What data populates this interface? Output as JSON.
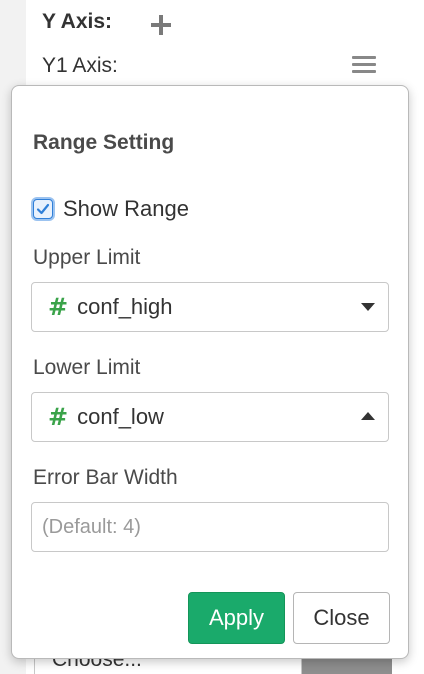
{
  "axis_panel": {
    "title": "Y Axis:",
    "y1_label": "Y1 Axis:",
    "choose_placeholder": "Choose..."
  },
  "popover": {
    "title": "Range Setting",
    "show_range_label": "Show Range",
    "show_range_checked": true,
    "upper_limit": {
      "label": "Upper Limit",
      "value": "conf_high",
      "type_icon": "#"
    },
    "lower_limit": {
      "label": "Lower Limit",
      "value": "conf_low",
      "type_icon": "#"
    },
    "error_bar_width": {
      "label": "Error Bar Width",
      "value": "",
      "placeholder": "(Default: 4)"
    },
    "apply_label": "Apply",
    "close_label": "Close"
  },
  "icons": {
    "add": "plus-icon",
    "menu": "hamburger-menu-icon",
    "numeric_column": "hash-icon",
    "dropdown_closed": "caret-down-icon",
    "dropdown_open": "caret-up-icon"
  },
  "colors": {
    "apply_button": "#1aaa6b",
    "hash_icon": "#3aa34a",
    "checkbox_focus": "#2f7fd8"
  }
}
